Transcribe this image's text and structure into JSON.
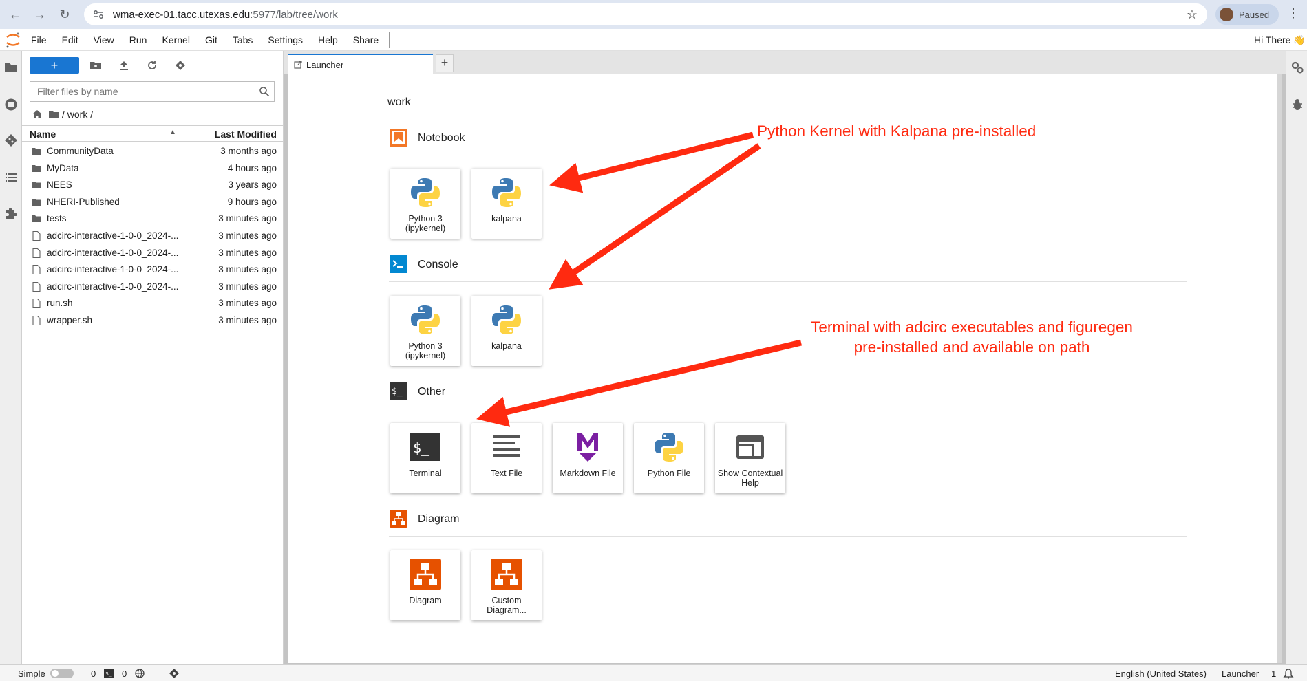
{
  "browser": {
    "url_host": "wma-exec-01.tacc.utexas.edu",
    "url_path": ":5977/lab/tree/work",
    "profile_status": "Paused"
  },
  "menu": [
    "File",
    "Edit",
    "View",
    "Run",
    "Kernel",
    "Git",
    "Tabs",
    "Settings",
    "Help",
    "Share"
  ],
  "user": {
    "greeting": "Hi There",
    "emoji": "👋"
  },
  "filebrowser": {
    "new_button": "+",
    "filter_placeholder": "Filter files by name",
    "breadcrumb": "/ work /",
    "col_name": "Name",
    "col_modified": "Last Modified",
    "files": [
      {
        "name": "CommunityData",
        "modified": "3 months ago",
        "type": "folder"
      },
      {
        "name": "MyData",
        "modified": "4 hours ago",
        "type": "folder"
      },
      {
        "name": "NEES",
        "modified": "3 years ago",
        "type": "folder"
      },
      {
        "name": "NHERI-Published",
        "modified": "9 hours ago",
        "type": "folder"
      },
      {
        "name": "tests",
        "modified": "3 minutes ago",
        "type": "folder"
      },
      {
        "name": "adcirc-interactive-1-0-0_2024-...",
        "modified": "3 minutes ago",
        "type": "file"
      },
      {
        "name": "adcirc-interactive-1-0-0_2024-...",
        "modified": "3 minutes ago",
        "type": "file"
      },
      {
        "name": "adcirc-interactive-1-0-0_2024-...",
        "modified": "3 minutes ago",
        "type": "file"
      },
      {
        "name": "adcirc-interactive-1-0-0_2024-...",
        "modified": "3 minutes ago",
        "type": "file"
      },
      {
        "name": "run.sh",
        "modified": "3 minutes ago",
        "type": "file"
      },
      {
        "name": "wrapper.sh",
        "modified": "3 minutes ago",
        "type": "file"
      }
    ]
  },
  "tabs": {
    "launcher": "Launcher",
    "new_tab": "+"
  },
  "launcher": {
    "cwd": "work",
    "sections": {
      "notebook": "Notebook",
      "console": "Console",
      "other": "Other",
      "diagram": "Diagram"
    },
    "cards": {
      "nb_python3": "Python 3 (ipykernel)",
      "nb_kalpana": "kalpana",
      "con_python3": "Python 3 (ipykernel)",
      "con_kalpana": "kalpana",
      "terminal": "Terminal",
      "text_file": "Text File",
      "markdown_file": "Markdown File",
      "python_file": "Python File",
      "contextual_help": "Show Contextual Help",
      "diagram": "Diagram",
      "custom_diagram": "Custom Diagram..."
    }
  },
  "annotations": {
    "kernel_note": "Python Kernel with Kalpana pre-installed",
    "terminal_note_line1": "Terminal with adcirc executables and figuregen",
    "terminal_note_line2": "pre-installed and available on path"
  },
  "statusbar": {
    "mode": "Simple",
    "kernels_count": "0",
    "terminals_count": "0",
    "language": "English (United States)",
    "active": "Launcher",
    "active_count": "1"
  },
  "colors": {
    "accent": "#1976d2",
    "annotation": "#ff2a10",
    "jupyter_orange": "#f37726",
    "diagram_orange": "#e65100"
  }
}
